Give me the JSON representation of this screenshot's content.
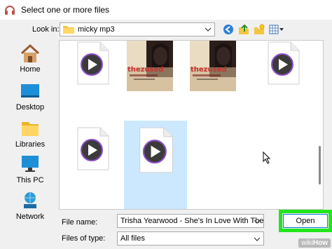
{
  "window": {
    "title": "Select one or more files"
  },
  "toolbar": {
    "look_in_label": "Look in:",
    "look_in_value": "micky mp3",
    "tools": [
      "back-icon",
      "up-folder-icon",
      "new-folder-icon",
      "view-menu-icon"
    ]
  },
  "places": [
    {
      "label": "Home",
      "icon": "home-icon"
    },
    {
      "label": "Desktop",
      "icon": "desktop-icon"
    },
    {
      "label": "Libraries",
      "icon": "libraries-icon"
    },
    {
      "label": "This PC",
      "icon": "this-pc-icon"
    },
    {
      "label": "Network",
      "icon": "network-icon"
    }
  ],
  "files": [
    {
      "kind": "audio",
      "selected": false
    },
    {
      "kind": "album-art",
      "art_text": "thezused",
      "selected": false
    },
    {
      "kind": "album-art",
      "art_text": "thezused",
      "selected": false
    },
    {
      "kind": "audio",
      "selected": false
    },
    {
      "kind": "audio",
      "selected": false
    },
    {
      "kind": "audio",
      "selected": true
    }
  ],
  "footer": {
    "file_name_label": "File name:",
    "file_name_value": "Trisha Yearwood - She's In Love With The Boy",
    "file_type_label": "Files of type:",
    "file_type_value": "All files",
    "open_label": "Open"
  },
  "watermark": {
    "prefix": "wiki",
    "suffix": "How"
  },
  "colors": {
    "selection": "#cce8ff",
    "highlight": "#22e61c",
    "accent": "#0078d7"
  }
}
